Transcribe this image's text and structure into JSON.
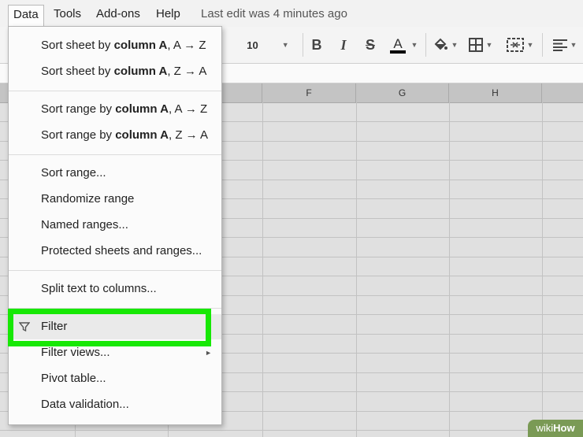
{
  "menubar": {
    "items": [
      "Data",
      "Tools",
      "Add-ons",
      "Help"
    ],
    "last_edit": "Last edit was 4 minutes ago"
  },
  "toolbar": {
    "font_size": "10",
    "icons": [
      "bold-icon",
      "italic-icon",
      "strikethrough-icon",
      "text-color-icon",
      "fill-color-icon",
      "borders-icon",
      "merge-cells-icon",
      "align-icon"
    ]
  },
  "grid": {
    "columns": [
      "F",
      "G",
      "H"
    ]
  },
  "dropdown": {
    "sort_sheet_az": {
      "pre": "Sort sheet by ",
      "bold": "column A",
      "post": ", A → Z"
    },
    "sort_sheet_za": {
      "pre": "Sort sheet by ",
      "bold": "column A",
      "post": ", Z → A"
    },
    "sort_range_az": {
      "pre": "Sort range by ",
      "bold": "column A",
      "post": ", A → Z"
    },
    "sort_range_za": {
      "pre": "Sort range by ",
      "bold": "column A",
      "post": ", Z → A"
    },
    "sort_range": "Sort range...",
    "randomize_range": "Randomize range",
    "named_ranges": "Named ranges...",
    "protected": "Protected sheets and ranges...",
    "split_text": "Split text to columns...",
    "filter": "Filter",
    "filter_views": "Filter views...",
    "pivot_table": "Pivot table...",
    "data_validation": "Data validation..."
  },
  "highlight_color": "#17e805",
  "watermark": {
    "prefix": "wiki",
    "suffix": "How"
  }
}
